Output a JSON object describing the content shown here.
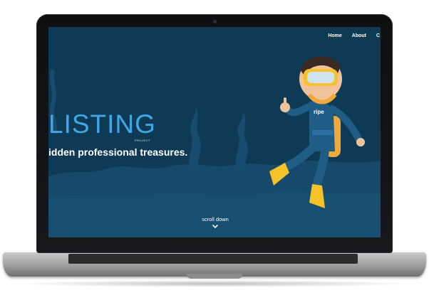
{
  "nav": {
    "items": [
      {
        "label": "Home"
      },
      {
        "label": "About"
      },
      {
        "label": "C"
      }
    ]
  },
  "hero": {
    "title": "LISTING",
    "subtitle": "PROJECT",
    "tagline": "idden professional treasures."
  },
  "scroll": {
    "label": "scroll down",
    "icon": "chevron-down-icon"
  },
  "diver": {
    "chest_label": "ripe"
  },
  "colors": {
    "screen_bg": "#0f3a55",
    "accent": "#3fa7e3",
    "seabed": "#16496a"
  }
}
